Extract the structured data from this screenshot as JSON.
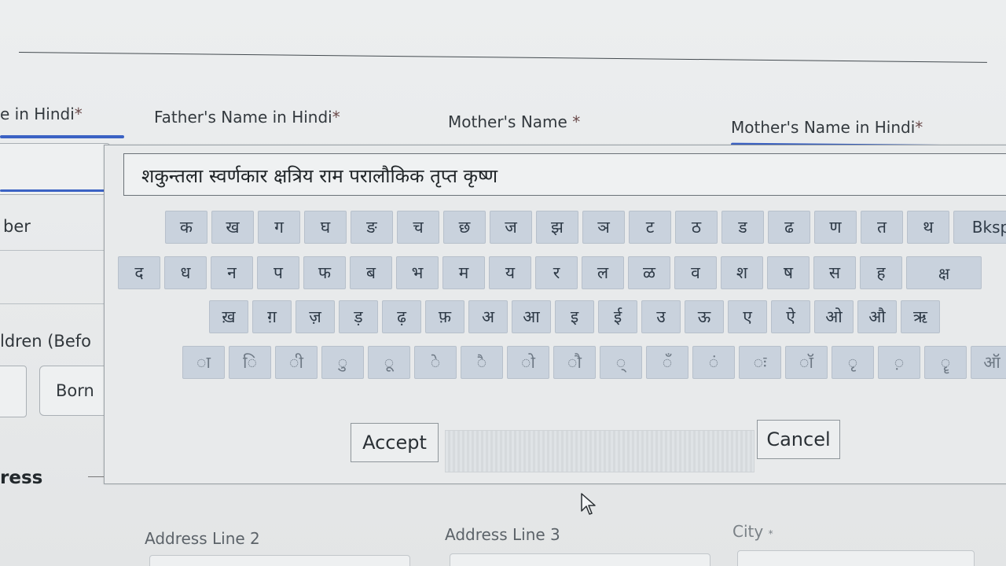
{
  "form": {
    "labels": {
      "name_in_hindi_partial": "e in Hindi",
      "fathers_name_in_hindi": "Father's Name in Hindi",
      "mothers_name": "Mother's Name",
      "mothers_name_in_hindi": "Mother's Name in Hindi",
      "required_mark": "*",
      "number_partial": "ber",
      "children_partial": "ldren (Befo",
      "address_partial": "ress",
      "address_line_2": "Address Line 2",
      "address_line_3": "Address Line 3",
      "city": "City",
      "city_required_mark": "*"
    },
    "born_button_label": "Born"
  },
  "keyboard": {
    "text_value": "शकुन्तला स्वर्णकार क्षत्रिय राम परालौकिक तृप्त कृष्ण",
    "rows": [
      [
        "क",
        "ख",
        "ग",
        "घ",
        "ङ",
        "च",
        "छ",
        "ज",
        "झ",
        "ञ",
        "ट",
        "ठ",
        "ड",
        "ढ",
        "ण",
        "त",
        "थ",
        "Bksp"
      ],
      [
        "द",
        "ध",
        "न",
        "प",
        "फ",
        "ब",
        "भ",
        "म",
        "य",
        "र",
        "ल",
        "ळ",
        "व",
        "श",
        "ष",
        "स",
        "ह",
        "क्ष"
      ],
      [
        "ख़",
        "ग़",
        "ज़",
        "ड़",
        "ढ़",
        "फ़",
        "अ",
        "आ",
        "इ",
        "ई",
        "उ",
        "ऊ",
        "ए",
        "ऐ",
        "ओ",
        "औ",
        "ऋ"
      ],
      [
        "ा",
        "ि",
        "ी",
        "ु",
        "ू",
        "े",
        "ै",
        "ो",
        "ौ",
        "्",
        "ँ",
        "ं",
        "ः",
        "ॉ",
        "ृ",
        "़",
        "ॄ",
        "ऑ"
      ]
    ],
    "accept_label": "Accept",
    "cancel_label": "Cancel"
  },
  "colors": {
    "accent_underline": "#3b62c4",
    "key_background": "#c9d2dd"
  },
  "icons": {
    "pointer": "mouse-pointer-icon"
  }
}
